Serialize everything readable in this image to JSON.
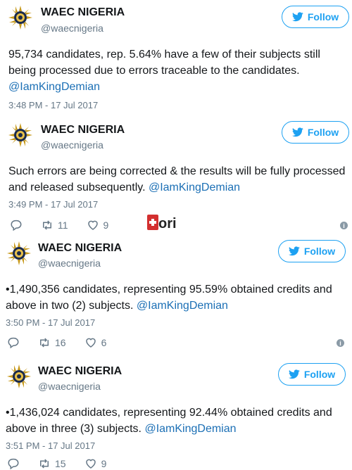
{
  "tweets": [
    {
      "name": "WAEC NIGERIA",
      "handle": "@waecnigeria",
      "follow_label": "Follow",
      "text": "95,734 candidates, rep. 5.64% have a few of their subjects still being processed due to errors traceable to the candidates.",
      "mention": "@IamKingDemian",
      "timestamp": "3:48 PM - 17 Jul 2017"
    },
    {
      "name": "WAEC NIGERIA",
      "handle": "@waecnigeria",
      "follow_label": "Follow",
      "text": "Such errors are being corrected & the results will be fully processed and released subsequently.",
      "mention": "@IamKingDemian",
      "timestamp": "3:49 PM - 17 Jul 2017",
      "retweets": "11",
      "likes": "9"
    },
    {
      "name": "WAEC NIGERIA",
      "handle": "@waecnigeria",
      "follow_label": "Follow",
      "text": "•1,490,356 candidates, representing 95.59% obtained credits and above in two (2) subjects.",
      "mention": "@IamKingDemian",
      "timestamp": "3:50 PM - 17 Jul 2017",
      "retweets": "16",
      "likes": "6"
    },
    {
      "name": "WAEC NIGERIA",
      "handle": "@waecnigeria",
      "follow_label": "Follow",
      "text": "•1,436,024 candidates, representing 92.44% obtained credits and above in three (3) subjects.",
      "mention": "@IamKingDemian",
      "timestamp": "3:51 PM - 17 Jul 2017",
      "retweets": "15",
      "likes": "9"
    }
  ],
  "watermark": {
    "text": "ori"
  },
  "icons": {
    "reply": "reply-icon",
    "retweet": "retweet-icon",
    "like": "heart-icon",
    "info": "info-icon",
    "bird": "twitter-bird-icon"
  },
  "colors": {
    "accent": "#1da1f2",
    "mention": "#1b6fb5",
    "muted": "#657786"
  }
}
